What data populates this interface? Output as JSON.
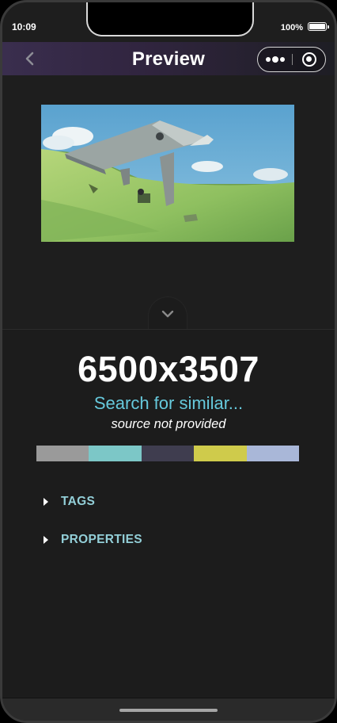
{
  "status_bar": {
    "time": "10:09",
    "battery": "100%"
  },
  "nav": {
    "title": "Preview"
  },
  "image": {
    "subject": "anime-style illustration of a floating concrete structure over a green hillside under a blue sky"
  },
  "info": {
    "resolution": "6500x3507",
    "search_link": "Search for similar...",
    "source": "source not provided"
  },
  "palette": [
    "#9a9a9a",
    "#7cc7c7",
    "#3f3d4f",
    "#cfcb4b",
    "#a9b7d8"
  ],
  "sections": {
    "tags": "TAGS",
    "properties": "PROPERTIES"
  },
  "colors": {
    "accent": "#66c9dc",
    "section_label": "#93cfd8"
  }
}
